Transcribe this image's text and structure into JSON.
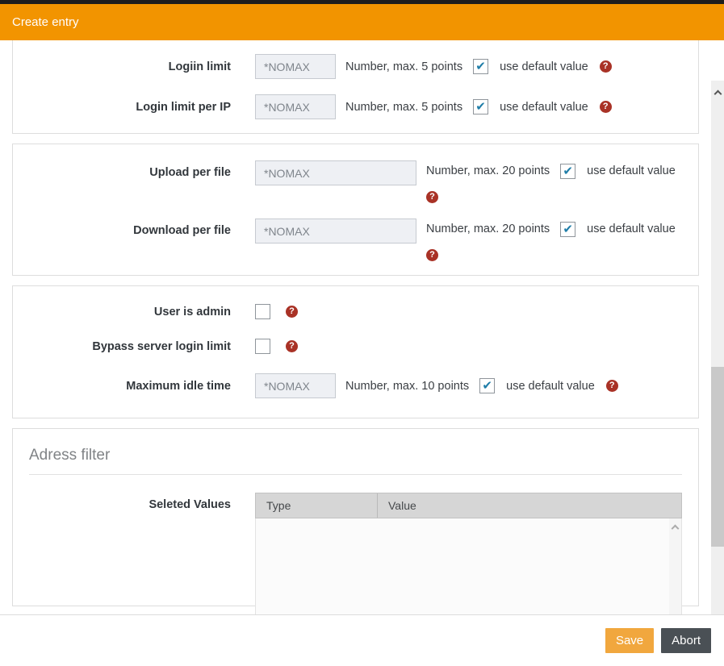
{
  "header": {
    "title": "Create entry"
  },
  "panels": {
    "limits": {
      "rows": [
        {
          "label": "Logiin limit",
          "placeholder": "*NOMAX",
          "desc": "Number, max. 5 points",
          "checkbox_label": "use default value",
          "checked": true
        },
        {
          "label": "Login limit per IP",
          "placeholder": "*NOMAX",
          "desc": "Number, max. 5 points",
          "checkbox_label": "use default value",
          "checked": true
        }
      ]
    },
    "transfer": {
      "rows": [
        {
          "label": "Upload per file",
          "placeholder": "*NOMAX",
          "desc": "Number, max. 20 points",
          "checkbox_label": "use default value",
          "checked": true
        },
        {
          "label": "Download per file",
          "placeholder": "*NOMAX",
          "desc": "Number, max. 20 points",
          "checkbox_label": "use default value",
          "checked": true
        }
      ]
    },
    "admin": {
      "rows": [
        {
          "label": "User is admin",
          "checked": false
        },
        {
          "label": "Bypass server login limit",
          "checked": false
        },
        {
          "label": "Maximum idle time",
          "placeholder": "*NOMAX",
          "desc": "Number, max. 10 points",
          "checkbox_label": "use default value",
          "checked": true
        }
      ]
    },
    "address_filter": {
      "heading": "Adress filter",
      "label": "Seleted Values",
      "table": {
        "columns": [
          "Type",
          "Value"
        ],
        "rows": []
      }
    }
  },
  "icons": {
    "help": "?",
    "check": "✔"
  },
  "footer": {
    "save_label": "Save",
    "abort_label": "Abort"
  },
  "colors": {
    "header_bg": "#f29400",
    "save_bg": "#f1a73e",
    "abort_bg": "#4a5055",
    "help_icon_bg": "#a93226",
    "checkmark": "#1f7da8",
    "table_header_bg": "#d6d6d6"
  }
}
